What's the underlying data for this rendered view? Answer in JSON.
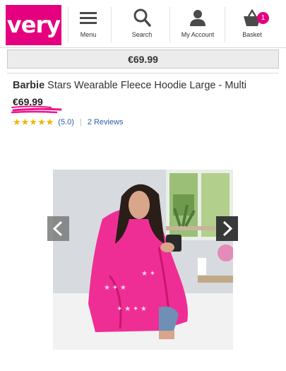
{
  "header": {
    "logo_text": "very",
    "brand_color": "#e4007e",
    "nav": [
      {
        "label": "Menu",
        "icon": "hamburger-menu-icon"
      },
      {
        "label": "Search",
        "icon": "search-icon"
      },
      {
        "label": "My Account",
        "icon": "user-icon"
      },
      {
        "label": "Basket",
        "icon": "basket-icon",
        "badge": "1"
      }
    ]
  },
  "price_bar": {
    "price": "€69.99"
  },
  "product": {
    "brand": "Barbie",
    "name": "Stars Wearable Fleece Hoodie Large - Multi",
    "price": "€69.99",
    "rating": {
      "stars": "★★★★★",
      "score": "(5.0)",
      "separator": "|",
      "reviews": "2 Reviews",
      "value": 5.0
    },
    "gallery": {
      "prev_icon": "chevron-left-icon",
      "next_icon": "chevron-right-icon"
    }
  }
}
